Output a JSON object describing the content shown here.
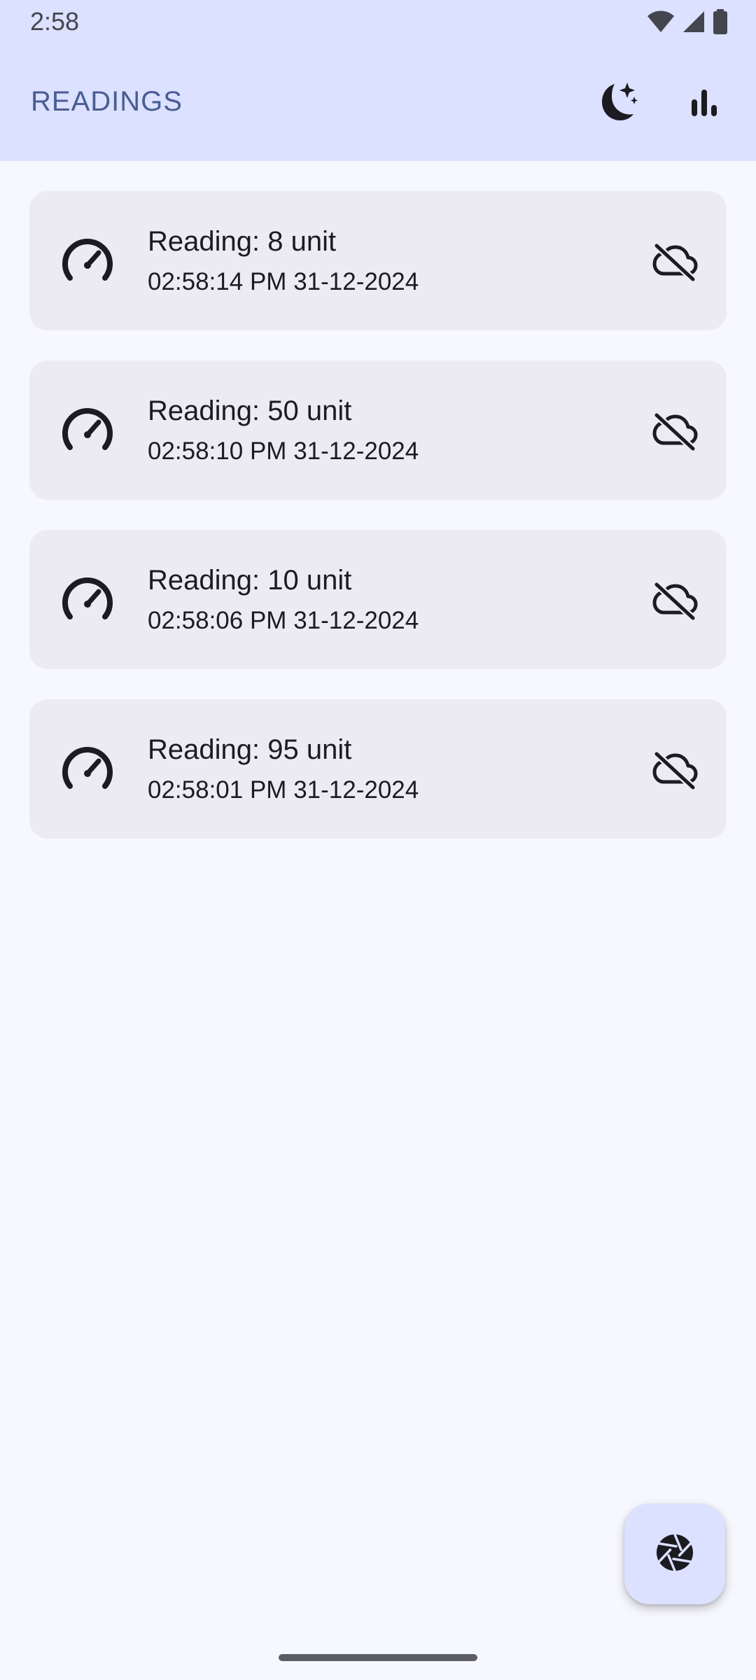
{
  "status_bar": {
    "time": "2:58",
    "icons": [
      "wifi-icon",
      "signal-icon",
      "battery-icon"
    ]
  },
  "app_bar": {
    "title": "READINGS",
    "actions": [
      {
        "icon": "dark-mode-icon"
      },
      {
        "icon": "bar-chart-icon"
      }
    ]
  },
  "readings": [
    {
      "title": "Reading: 8 unit",
      "timestamp": "02:58:14 PM 31-12-2024",
      "leading_icon": "speedometer-icon",
      "trailing_icon": "cloud-off-icon"
    },
    {
      "title": "Reading: 50 unit",
      "timestamp": "02:58:10 PM 31-12-2024",
      "leading_icon": "speedometer-icon",
      "trailing_icon": "cloud-off-icon"
    },
    {
      "title": "Reading: 10 unit",
      "timestamp": "02:58:06 PM 31-12-2024",
      "leading_icon": "speedometer-icon",
      "trailing_icon": "cloud-off-icon"
    },
    {
      "title": "Reading: 95 unit",
      "timestamp": "02:58:01 PM 31-12-2024",
      "leading_icon": "speedometer-icon",
      "trailing_icon": "cloud-off-icon"
    }
  ],
  "fab": {
    "icon": "camera-shutter-icon"
  },
  "colors": {
    "app_bar_bg": "#DBE1FF",
    "title": "#4A5C92",
    "page_bg": "#F7F7FE",
    "card_bg": "#ECEBF1",
    "fab_bg": "#DBE1FF"
  }
}
